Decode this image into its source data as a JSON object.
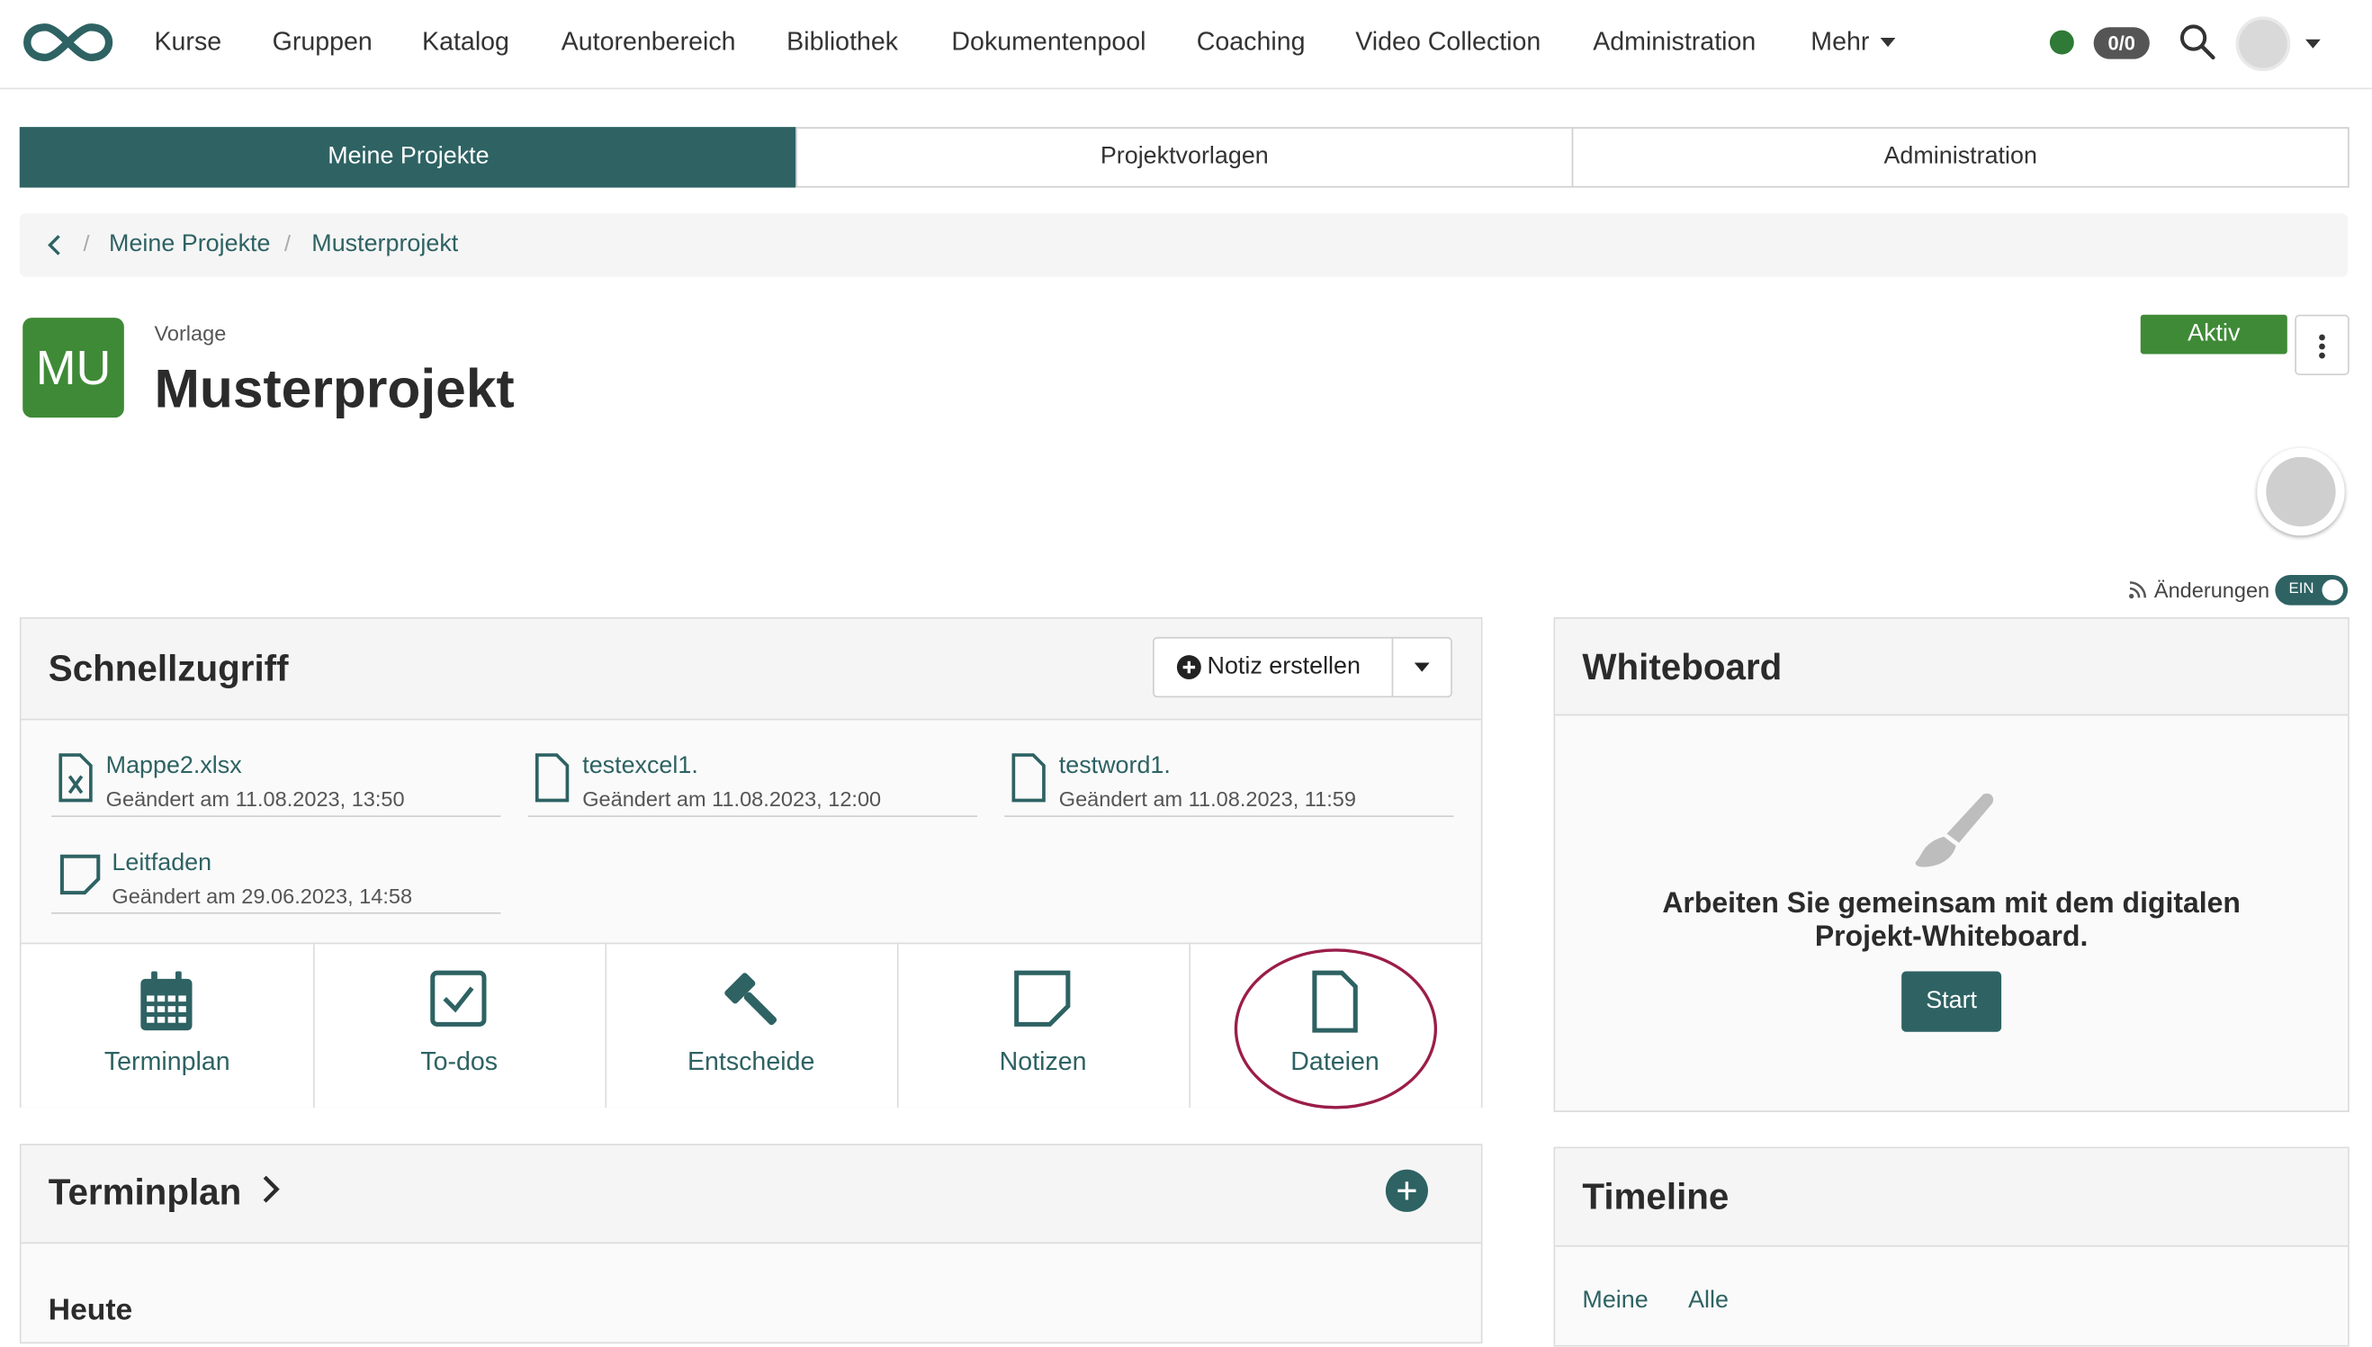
{
  "nav": {
    "items": [
      "Kurse",
      "Gruppen",
      "Katalog",
      "Autorenbereich",
      "Bibliothek",
      "Dokumentenpool",
      "Coaching",
      "Video Collection",
      "Administration"
    ],
    "more_label": "Mehr",
    "counter": "0/0",
    "status_color": "#2f7a36"
  },
  "tabs": [
    "Meine Projekte",
    "Projektvorlagen",
    "Administration"
  ],
  "breadcrumb": [
    "Meine Projekte",
    "Musterprojekt"
  ],
  "project": {
    "initials": "MU",
    "kicker": "Vorlage",
    "title": "Musterprojekt",
    "status": "Aktiv",
    "feed_label": "Änderungen",
    "feed_toggle": "EIN"
  },
  "quick": {
    "title": "Schnellzugriff",
    "create_button": "Notiz erstellen",
    "files": [
      {
        "name": "Mappe2.xlsx",
        "meta": "Geändert am 11.08.2023, 13:50",
        "icon": "excel-file-icon"
      },
      {
        "name": "testexcel1.",
        "meta": "Geändert am 11.08.2023, 12:00",
        "icon": "file-icon"
      },
      {
        "name": "testword1.",
        "meta": "Geändert am 11.08.2023, 11:59",
        "icon": "file-icon"
      },
      {
        "name": "Leitfaden",
        "meta": "Geändert am 29.06.2023, 14:58",
        "icon": "note-icon"
      }
    ],
    "tiles": [
      "Terminplan",
      "To-dos",
      "Entscheide",
      "Notizen",
      "Dateien"
    ]
  },
  "terminplan": {
    "title": "Terminplan",
    "today": "Heute"
  },
  "whiteboard": {
    "title": "Whiteboard",
    "text_line1": "Arbeiten Sie gemeinsam mit dem digitalen",
    "text_line2": "Projekt-Whiteboard.",
    "button": "Start"
  },
  "timeline": {
    "title": "Timeline",
    "filters": [
      "Meine",
      "Alle"
    ]
  },
  "colors": {
    "accent": "#2e6263",
    "active_green": "#3f8a37",
    "highlight": "#9b1d4a"
  }
}
